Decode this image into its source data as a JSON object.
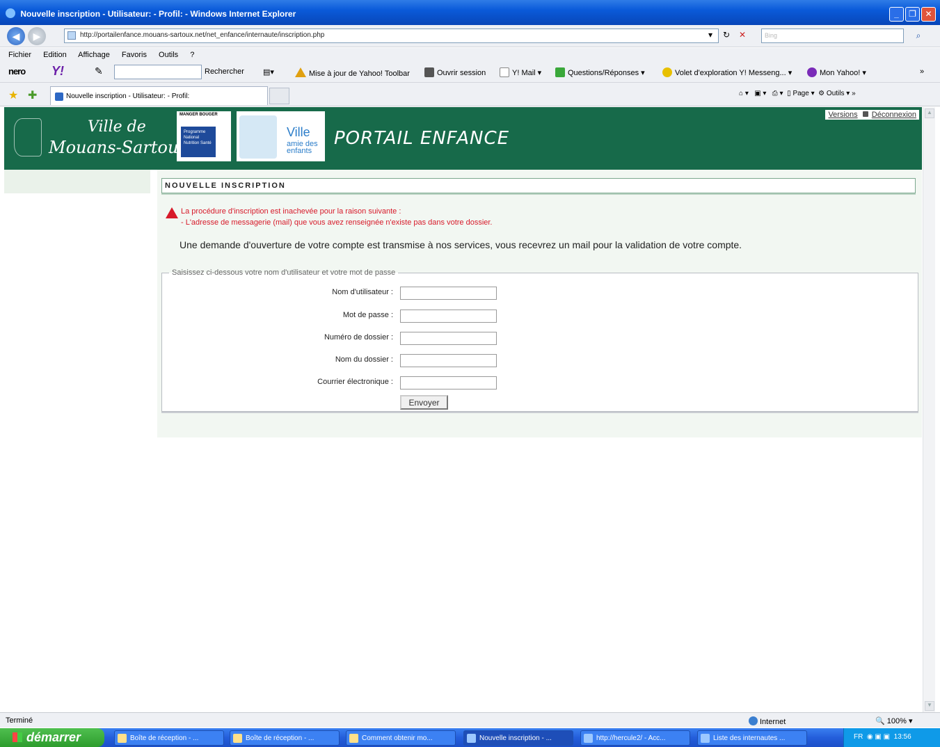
{
  "window": {
    "title": "Nouvelle inscription - Utilisateur: - Profil: - Windows Internet Explorer"
  },
  "address_bar": {
    "url": "http://portailenfance.mouans-sartoux.net/net_enfance/internaute/inscription.php",
    "search_placeholder": "Bing"
  },
  "menu": [
    "Fichier",
    "Edition",
    "Affichage",
    "Favoris",
    "Outils",
    "?"
  ],
  "toolbar": {
    "nero": "nero",
    "yahoo": "Y!",
    "rechercher": "Rechercher",
    "update": "Mise à jour de Yahoo! Toolbar",
    "open_session": "Ouvrir session",
    "mail": "Y! Mail",
    "qa": "Questions/Réponses",
    "messenger": "Volet d'exploration Y! Messeng...",
    "my_yahoo": "Mon Yahoo!"
  },
  "tabs": {
    "active_tab": "Nouvelle inscription - Utilisateur: - Profil:"
  },
  "command_bar": {
    "page": "Page",
    "tools": "Outils"
  },
  "site": {
    "logo_line1": "Ville de",
    "logo_line2": "Mouans-Sartoux",
    "pnns_top": "MANGER BOUGER",
    "pnns_box": "Programme National Nutrition Santé",
    "ville_logo": "Ville",
    "ville_sub1": "amie des",
    "ville_sub2": "enfants",
    "title": "PORTAIL ENFANCE",
    "link_versions": "Versions",
    "link_logout": "Déconnexion"
  },
  "form": {
    "section_title": "NOUVELLE INSCRIPTION",
    "error_line1": "La procédure d'inscription est inachevée pour la raison suivante :",
    "error_line2": "- L'adresse de messagerie (mail) que vous avez renseignée n'existe pas dans votre dossier.",
    "info": "Une demande d'ouverture de votre compte est transmise à nos services, vous recevrez un mail pour la validation de votre compte.",
    "legend": "Saisissez ci-dessous votre nom d'utilisateur et votre mot de passe",
    "fields": [
      {
        "label": "Nom d'utilisateur :",
        "value": ""
      },
      {
        "label": "Mot de passe :",
        "value": ""
      },
      {
        "label": "Numéro de dossier :",
        "value": ""
      },
      {
        "label": "Nom du dossier :",
        "value": ""
      },
      {
        "label": "Courrier électronique :",
        "value": ""
      }
    ],
    "submit": "Envoyer"
  },
  "status": {
    "left": "Terminé",
    "zone": "Internet",
    "zoom": "100%"
  },
  "taskbar": {
    "start": "démarrer",
    "items": [
      "Boîte de réception - ...",
      "Boîte de réception - ...",
      "Comment obtenir mo...",
      "Nouvelle inscription - ...",
      "http://hercule2/ - Acc...",
      "Liste des internautes ..."
    ],
    "tray_lang": "FR",
    "clock": "13:56"
  },
  "colors": {
    "banner_green": "#176a4a",
    "error_red": "#d71a2a",
    "xp_blue": "#245edb"
  }
}
